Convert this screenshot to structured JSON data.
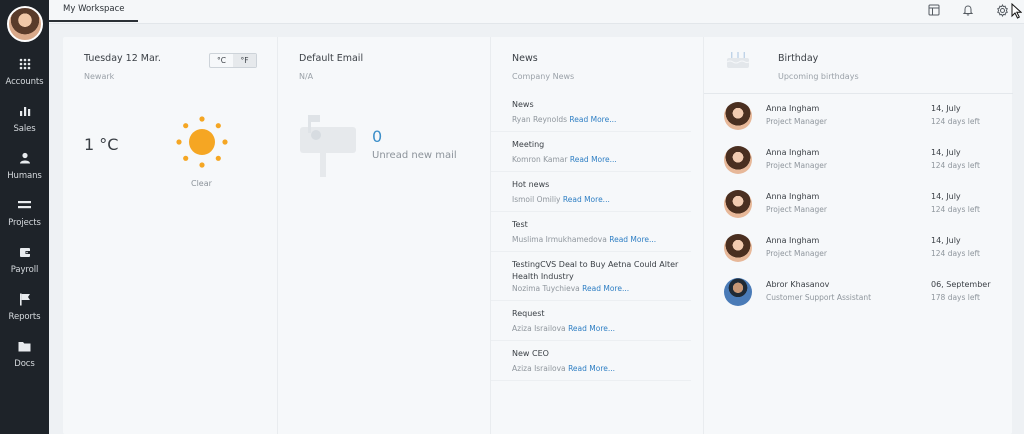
{
  "sidebar": {
    "items": [
      {
        "label": "Accounts",
        "icon": "grid-icon"
      },
      {
        "label": "Sales",
        "icon": "bar-chart-icon"
      },
      {
        "label": "Humans",
        "icon": "person-icon"
      },
      {
        "label": "Projects",
        "icon": "projects-icon"
      },
      {
        "label": "Payroll",
        "icon": "wallet-icon"
      },
      {
        "label": "Reports",
        "icon": "flag-icon"
      },
      {
        "label": "Docs",
        "icon": "folder-icon"
      }
    ]
  },
  "topbar": {
    "tab_label": "My Workspace",
    "icons": [
      "layout-icon",
      "bell-icon",
      "gear-icon"
    ]
  },
  "weather": {
    "date": "Tuesday 12 Mar.",
    "city": "Newark",
    "unit_c": "°C",
    "unit_f": "°F",
    "temperature": "1 °C",
    "condition": "Clear",
    "sun_color": "#f5a623"
  },
  "email": {
    "title": "Default Email",
    "subtitle": "N/A",
    "count": "0",
    "label": "Unread new mail"
  },
  "news": {
    "title": "News",
    "subtitle": "Company News",
    "read_more": "Read More...",
    "items": [
      {
        "title": "News",
        "author": "Ryan Reynolds"
      },
      {
        "title": "Meeting",
        "author": "Komron Kamar"
      },
      {
        "title": "Hot news",
        "author": "Ismoil Omiliy"
      },
      {
        "title": "Test",
        "author": "Muslima Irmukhamedova"
      },
      {
        "title": "TestingCVS Deal to Buy Aetna Could Alter Health Industry",
        "author": "Nozima Tuychieva"
      },
      {
        "title": "Request",
        "author": "Aziza Israilova"
      },
      {
        "title": "New CEO",
        "author": "Aziza Israilova"
      }
    ]
  },
  "birthday": {
    "title": "Birthday",
    "subtitle": "Upcoming birthdays",
    "items": [
      {
        "name": "Anna Ingham",
        "role": "Project Manager",
        "date": "14, July",
        "left": "124 days left"
      },
      {
        "name": "Anna Ingham",
        "role": "Project Manager",
        "date": "14, July",
        "left": "124 days left"
      },
      {
        "name": "Anna Ingham",
        "role": "Project Manager",
        "date": "14, July",
        "left": "124 days left"
      },
      {
        "name": "Anna Ingham",
        "role": "Project Manager",
        "date": "14, July",
        "left": "124 days left"
      },
      {
        "name": "Abror Khasanov",
        "role": "Customer Support Assistant",
        "date": "06, September",
        "left": "178 days left"
      }
    ]
  },
  "colors": {
    "sidebar_bg": "#1e2329",
    "accent_blue": "#2f7fc4",
    "mail_count": "#3d8fc9"
  }
}
